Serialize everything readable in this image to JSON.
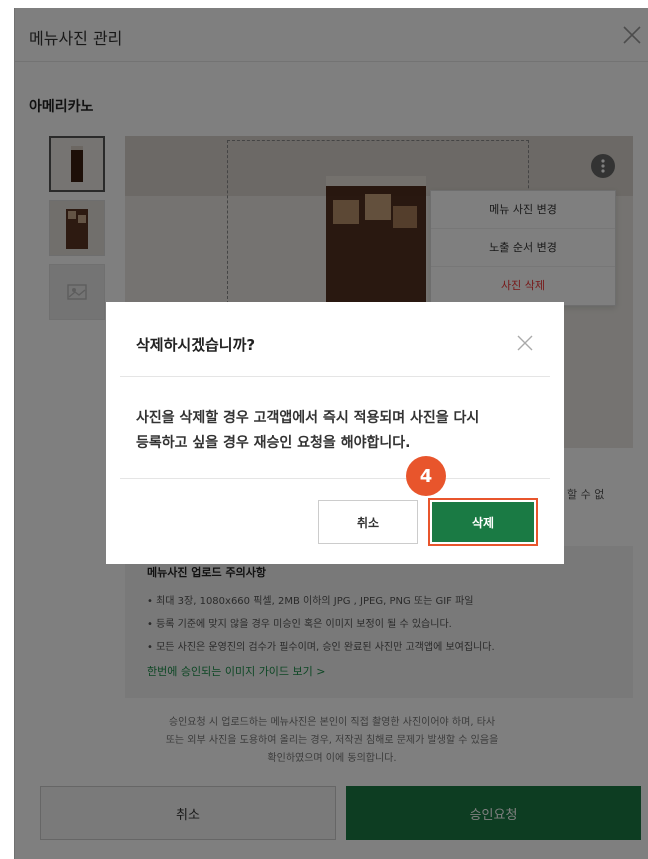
{
  "header": {
    "title": "메뉴사진 관리"
  },
  "product": {
    "name": "아메리카노"
  },
  "context_menu": {
    "items": [
      {
        "label": "메뉴 사진 변경"
      },
      {
        "label": "노출 순서 변경"
      },
      {
        "label": "사진 삭제"
      }
    ]
  },
  "behind_note": "할 수 없",
  "notice": {
    "title": "메뉴사진 업로드 주의사항",
    "lines": [
      "• 최대 3장, 1080x660 픽셀, 2MB 이하의 JPG , JPEG, PNG 또는 GIF 파일",
      "• 등록 기준에 맞지 않을 경우 미승인 혹은 이미지 보정이 될 수 있습니다.",
      "• 모든 사진은 운영진의 검수가 필수이며, 승인 완료된 사진만 고객앱에 보여집니다."
    ],
    "link": "한번에 승인되는 이미지 가이드 보기  >"
  },
  "consent": {
    "line1": "승인요청 시 업로드하는 메뉴사진은 본인이 직접 촬영한 사진이어야 하며, 타사",
    "line2": "또는 외부 사진을 도용하여 올리는 경우, 저작권 침해로 문제가 발생할 수 있음을",
    "line3": "확인하였으며 이에 동의합니다."
  },
  "footer": {
    "cancel_label": "취소",
    "submit_label": "승인요청"
  },
  "modal": {
    "title": "삭제하시겠습니까?",
    "body_line1": "사진을 삭제할 경우 고객앱에서 즉시 적용되며 사진을 다시",
    "body_line2": "등록하고 싶을 경우 재승인 요청을 해야합니다.",
    "cancel_label": "취소",
    "delete_label": "삭제"
  },
  "step_badge": "4",
  "colors": {
    "primary_green": "#1a7a44",
    "highlight_orange": "#e8552c",
    "danger_red": "#ee3333"
  }
}
